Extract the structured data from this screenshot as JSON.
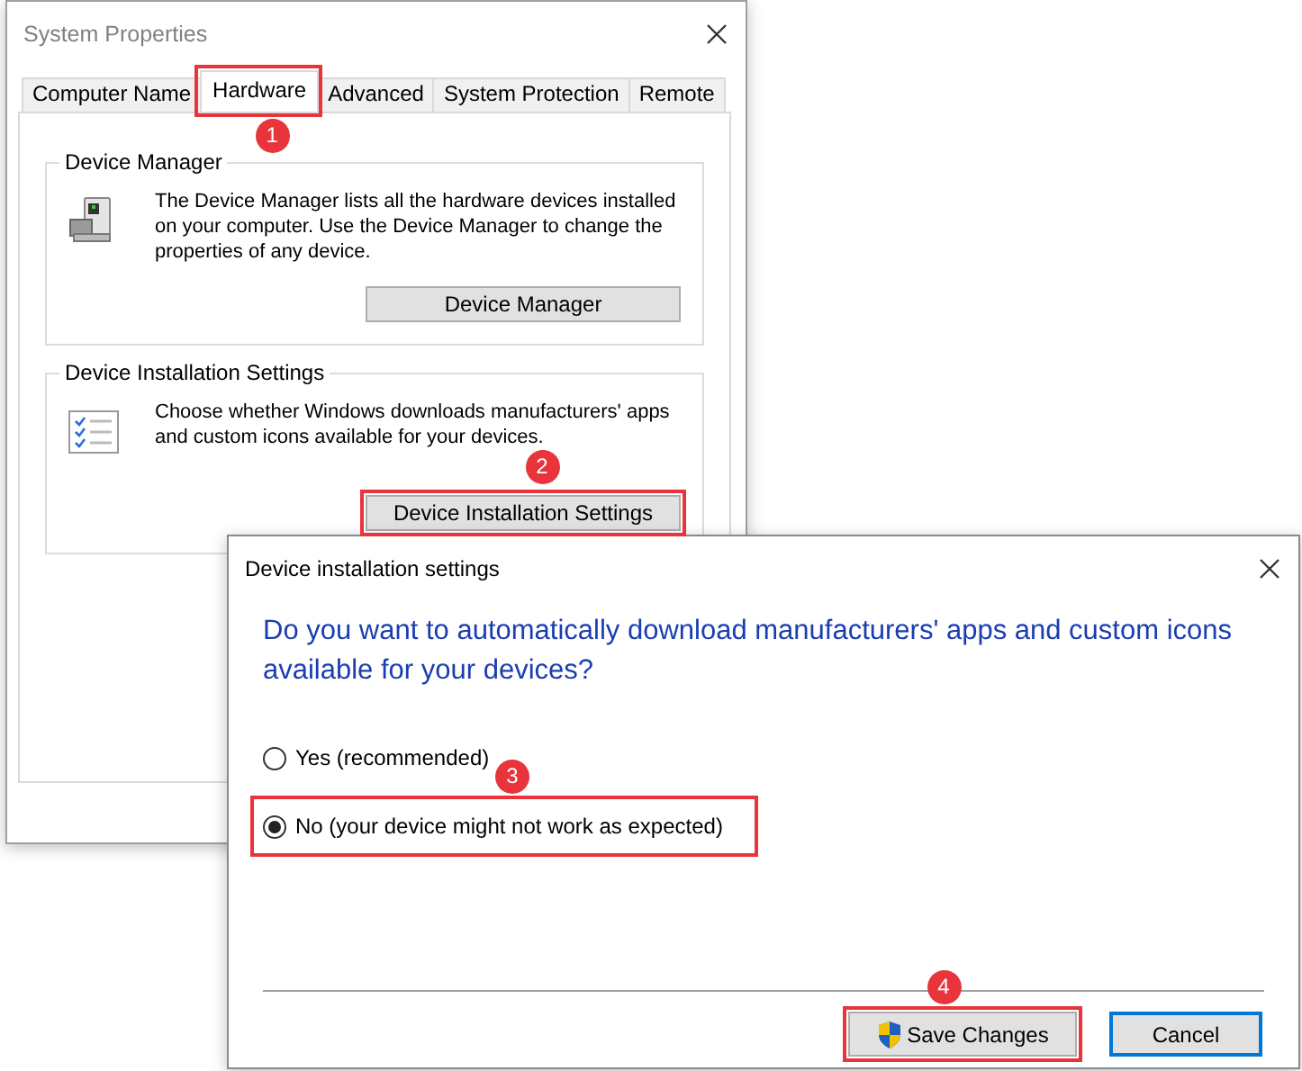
{
  "system_properties": {
    "title": "System Properties",
    "tabs": [
      {
        "label": "Computer Name",
        "selected": false,
        "highlighted": false
      },
      {
        "label": "Hardware",
        "selected": true,
        "highlighted": true,
        "marker": "1"
      },
      {
        "label": "Advanced",
        "selected": false,
        "highlighted": false
      },
      {
        "label": "System Protection",
        "selected": false,
        "highlighted": false
      },
      {
        "label": "Remote",
        "selected": false,
        "highlighted": false
      }
    ],
    "groups": [
      {
        "title": "Device Manager",
        "kind": "device",
        "description": "The Device Manager lists all the hardware devices installed on your computer. Use the Device Manager to change the properties of any device.",
        "button": {
          "label": "Device Manager",
          "highlighted": false
        }
      },
      {
        "title": "Device Installation Settings",
        "kind": "checklist",
        "description": "Choose whether Windows downloads manufacturers' apps and custom icons available for your devices.",
        "button": {
          "label": "Device Installation Settings",
          "highlighted": true,
          "marker": "2"
        }
      }
    ]
  },
  "dialog": {
    "title": "Device installation settings",
    "question": "Do you want to automatically download manufacturers' apps and custom icons available for your devices?",
    "options": [
      {
        "label": "Yes (recommended)",
        "selected": false,
        "highlighted": false
      },
      {
        "label": "No (your device might not work as expected)",
        "selected": true,
        "highlighted": true,
        "marker": "3"
      }
    ],
    "buttons": [
      {
        "label": "Save Changes",
        "kind": "admin",
        "default": false,
        "highlighted": true,
        "marker": "4"
      },
      {
        "label": "Cancel",
        "kind": "plain",
        "default": true,
        "highlighted": false
      }
    ]
  }
}
